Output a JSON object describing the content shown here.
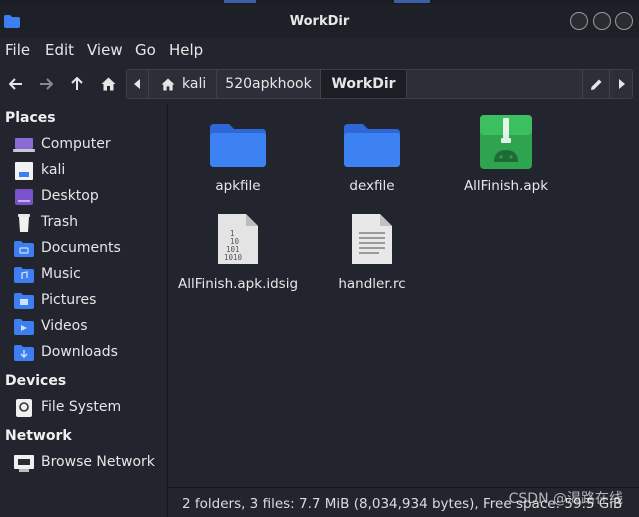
{
  "window": {
    "title": "WorkDir"
  },
  "menu": {
    "items": [
      "File",
      "Edit",
      "View",
      "Go",
      "Help"
    ]
  },
  "path": {
    "segments": [
      "kali",
      "520apkhook",
      "WorkDir"
    ]
  },
  "sidebar": {
    "sections": [
      {
        "heading": "Places",
        "items": [
          {
            "label": "Computer",
            "icon": "computer-icon"
          },
          {
            "label": "kali",
            "icon": "home-folder-icon"
          },
          {
            "label": "Desktop",
            "icon": "desktop-icon"
          },
          {
            "label": "Trash",
            "icon": "trash-icon"
          },
          {
            "label": "Documents",
            "icon": "documents-folder-icon"
          },
          {
            "label": "Music",
            "icon": "music-folder-icon"
          },
          {
            "label": "Pictures",
            "icon": "pictures-folder-icon"
          },
          {
            "label": "Videos",
            "icon": "videos-folder-icon"
          },
          {
            "label": "Downloads",
            "icon": "downloads-folder-icon"
          }
        ]
      },
      {
        "heading": "Devices",
        "items": [
          {
            "label": "File System",
            "icon": "drive-icon"
          }
        ]
      },
      {
        "heading": "Network",
        "items": [
          {
            "label": "Browse Network",
            "icon": "network-icon"
          }
        ]
      }
    ]
  },
  "files": [
    {
      "name": "apkfile",
      "icon": "folder-icon"
    },
    {
      "name": "dexfile",
      "icon": "folder-icon"
    },
    {
      "name": "AllFinish.apk",
      "icon": "android-package-icon"
    },
    {
      "name": "AllFinish.apk.idsig",
      "icon": "binary-file-icon"
    },
    {
      "name": "handler.rc",
      "icon": "text-file-icon"
    }
  ],
  "status": {
    "text": "2 folders, 3 files: 7.7 MiB (8,034,934 bytes), Free space: 59.5 GiB",
    "watermark": "CSDN @渴路在线"
  },
  "colors": {
    "accent": "#3b82f6",
    "folder": "#3d7ef0",
    "android": "#2fa44f"
  }
}
